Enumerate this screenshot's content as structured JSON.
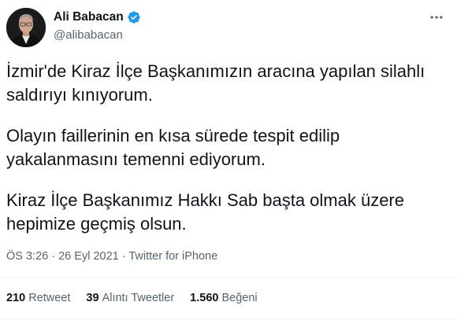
{
  "author": {
    "display_name": "Ali Babacan",
    "handle": "@alibabacan",
    "verified": true,
    "avatar_icon": "user-avatar-portrait"
  },
  "more_icon": "more-horizontal-icon",
  "tweet": {
    "paragraphs": [
      "İzmir'de Kiraz İlçe Başkanımızın aracına yapılan silahlı saldırıyı kınıyorum.",
      "Olayın faillerinin en kısa sürede tespit edilip yakalanmasını temenni ediyorum.",
      "Kiraz İlçe Başkanımız Hakkı Sab başta olmak üzere hepimize geçmiş olsun."
    ]
  },
  "meta": {
    "time": "ÖS 3:26",
    "separator": "·",
    "date": "26 Eyl 2021",
    "source": "Twitter for iPhone"
  },
  "stats": {
    "retweets": {
      "count": "210",
      "label": "Retweet"
    },
    "quotes": {
      "count": "39",
      "label": "Alıntı Tweetler"
    },
    "likes": {
      "count": "1.560",
      "label": "Beğeni"
    }
  },
  "colors": {
    "text": "#0f1419",
    "secondary": "#536471",
    "verified_blue": "#1d9bf0",
    "divider": "#eff3f4"
  }
}
